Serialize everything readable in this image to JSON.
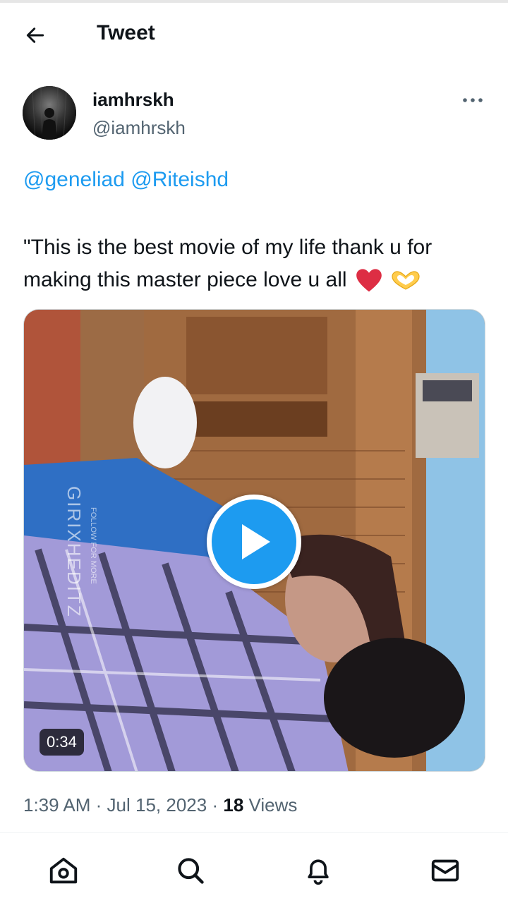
{
  "header": {
    "title": "Tweet",
    "back_icon": "arrow-left-icon"
  },
  "tweet": {
    "author": {
      "display_name": "iamhrskh",
      "handle": "@iamhrskh"
    },
    "mentions": [
      "@geneliad",
      "@Riteishd"
    ],
    "text": "\"This is the best movie of my life thank u for making this master piece love u all",
    "emojis": [
      "red-heart-emoji",
      "heart-hands-emoji"
    ],
    "media": {
      "type": "video",
      "duration": "0:34",
      "watermark_text": "GIRIXHEDITZ",
      "watermark_subtext": "FOLLOW FOR MORE"
    },
    "time": "1:39 AM",
    "separator": "·",
    "date": "Jul 15, 2023",
    "views_count": "18",
    "views_label": "Views"
  },
  "bottom_nav": {
    "items": [
      "home-icon",
      "search-icon",
      "notifications-icon",
      "messages-icon"
    ]
  },
  "colors": {
    "accent": "#1d9bf0",
    "text_primary": "#0f1419",
    "text_secondary": "#536471"
  }
}
